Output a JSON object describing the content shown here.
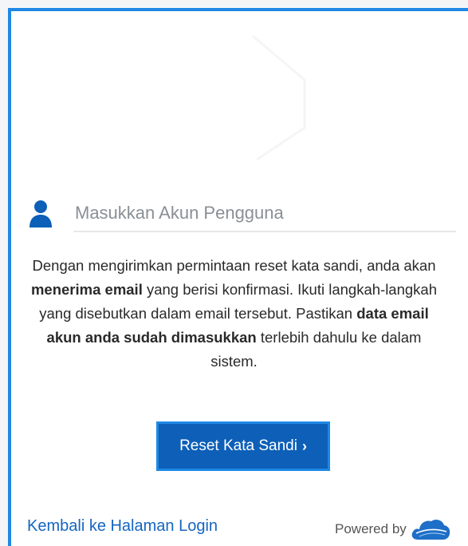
{
  "form": {
    "account_placeholder": "Masukkan Akun Pengguna",
    "account_value": ""
  },
  "info": {
    "part1": "Dengan mengirimkan permintaan reset kata sandi, anda akan ",
    "bold1": "menerima email",
    "part2": " yang berisi konfirmasi. Ikuti langkah-langkah yang disebutkan dalam email tersebut. Pastikan ",
    "bold2": "data email akun anda sudah dimasukkan",
    "part3": " terlebih dahulu ke dalam sistem."
  },
  "reset_button": {
    "label": "Reset Kata Sandi",
    "icon": "chevron-right-icon"
  },
  "footer": {
    "back_link": "Kembali ke Halaman Login",
    "powered_by": "Powered by",
    "powered_logo": "cloud-logo"
  },
  "colors": {
    "accent": "#1E88E5",
    "button_bg": "#0D5FB8",
    "link": "#1565C0"
  }
}
